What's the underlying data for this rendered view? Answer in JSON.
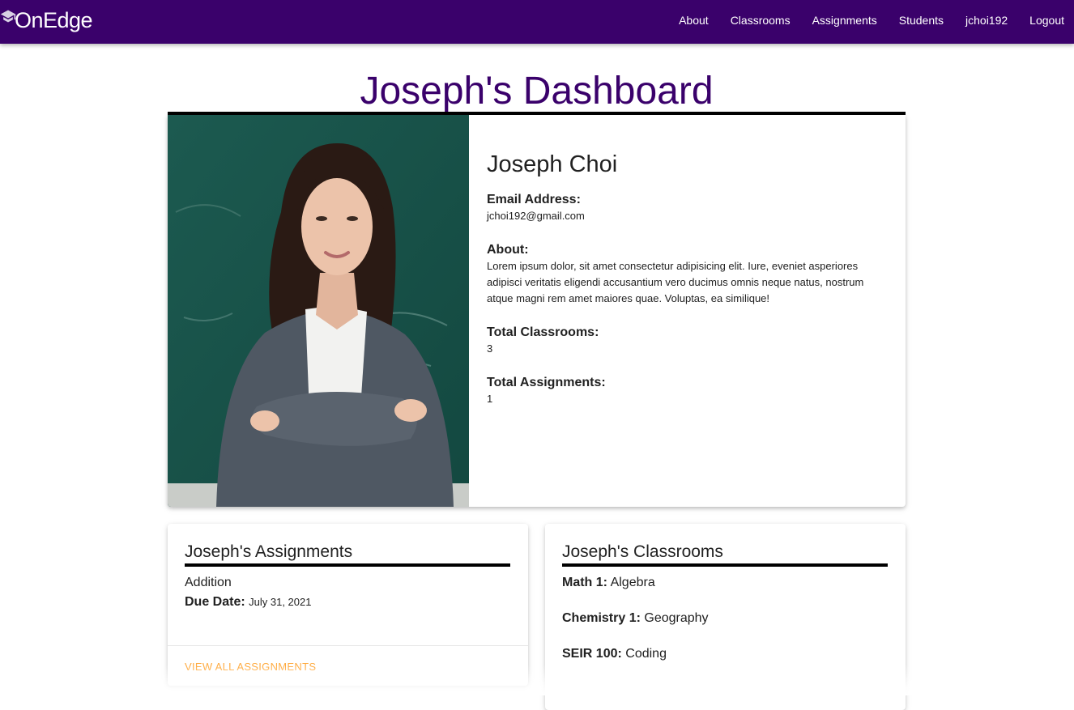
{
  "nav": {
    "brand": "OnEdge",
    "brand_icon": "graduation-cap-icon",
    "links": [
      "About",
      "Classrooms",
      "Assignments",
      "Students",
      "jchoi192",
      "Logout"
    ]
  },
  "page": {
    "title": "Joseph's Dashboard"
  },
  "profile": {
    "name": "Joseph Choi",
    "email_label": "Email Address:",
    "email": "jchoi192@gmail.com",
    "about_label": "About:",
    "about": "Lorem ipsum dolor, sit amet consectetur adipisicing elit. Iure, eveniet asperiores adipisci veritatis eligendi accusantium vero ducimus omnis neque natus, nostrum atque magni rem amet maiores quae. Voluptas, ea similique!",
    "classrooms_label": "Total Classrooms:",
    "classrooms": "3",
    "assignments_label": "Total Assignments:",
    "assignments": "1"
  },
  "assignments_card": {
    "title": "Joseph's Assignments",
    "items": [
      {
        "name": "Addition",
        "due_label": "Due Date:",
        "due": "July 31, 2021"
      }
    ],
    "action": "VIEW ALL ASSIGNMENTS"
  },
  "classrooms_card": {
    "title": "Joseph's Classrooms",
    "items": [
      {
        "name": "Math 1:",
        "subject": "Algebra"
      },
      {
        "name": "Chemistry 1:",
        "subject": "Geography"
      },
      {
        "name": "SEIR 100:",
        "subject": "Coding"
      }
    ]
  },
  "colors": {
    "nav_bg": "#3a016b",
    "title": "#3a016b",
    "action_link": "#ffab40"
  }
}
